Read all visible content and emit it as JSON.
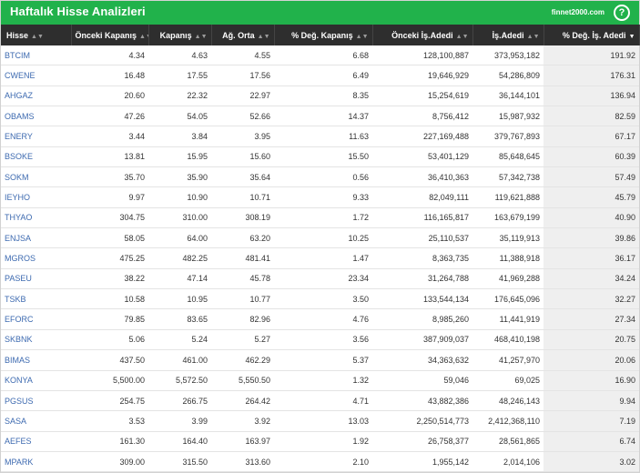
{
  "title": "Haftalık Hisse Analizleri",
  "brand": "finnet2000.com",
  "help": "?",
  "columns": [
    "Hisse",
    "Önceki Kapanış",
    "Kapanış",
    "Ağ. Orta",
    "% Değ. Kapanış",
    "Önceki İş.Adedi",
    "İş.Adedi",
    "% Değ. İş. Adedi"
  ],
  "sort_icons": {
    "both": "▲▼",
    "desc": "▼"
  },
  "rows": [
    [
      "BTCIM",
      "4.34",
      "4.63",
      "4.55",
      "6.68",
      "128,100,887",
      "373,953,182",
      "191.92"
    ],
    [
      "CWENE",
      "16.48",
      "17.55",
      "17.56",
      "6.49",
      "19,646,929",
      "54,286,809",
      "176.31"
    ],
    [
      "AHGAZ",
      "20.60",
      "22.32",
      "22.97",
      "8.35",
      "15,254,619",
      "36,144,101",
      "136.94"
    ],
    [
      "OBAMS",
      "47.26",
      "54.05",
      "52.66",
      "14.37",
      "8,756,412",
      "15,987,932",
      "82.59"
    ],
    [
      "ENERY",
      "3.44",
      "3.84",
      "3.95",
      "11.63",
      "227,169,488",
      "379,767,893",
      "67.17"
    ],
    [
      "BSOKE",
      "13.81",
      "15.95",
      "15.60",
      "15.50",
      "53,401,129",
      "85,648,645",
      "60.39"
    ],
    [
      "SOKM",
      "35.70",
      "35.90",
      "35.64",
      "0.56",
      "36,410,363",
      "57,342,738",
      "57.49"
    ],
    [
      "IEYHO",
      "9.97",
      "10.90",
      "10.71",
      "9.33",
      "82,049,111",
      "119,621,888",
      "45.79"
    ],
    [
      "THYAO",
      "304.75",
      "310.00",
      "308.19",
      "1.72",
      "116,165,817",
      "163,679,199",
      "40.90"
    ],
    [
      "ENJSA",
      "58.05",
      "64.00",
      "63.20",
      "10.25",
      "25,110,537",
      "35,119,913",
      "39.86"
    ],
    [
      "MGROS",
      "475.25",
      "482.25",
      "481.41",
      "1.47",
      "8,363,735",
      "11,388,918",
      "36.17"
    ],
    [
      "PASEU",
      "38.22",
      "47.14",
      "45.78",
      "23.34",
      "31,264,788",
      "41,969,288",
      "34.24"
    ],
    [
      "TSKB",
      "10.58",
      "10.95",
      "10.77",
      "3.50",
      "133,544,134",
      "176,645,096",
      "32.27"
    ],
    [
      "EFORC",
      "79.85",
      "83.65",
      "82.96",
      "4.76",
      "8,985,260",
      "11,441,919",
      "27.34"
    ],
    [
      "SKBNK",
      "5.06",
      "5.24",
      "5.27",
      "3.56",
      "387,909,037",
      "468,410,198",
      "20.75"
    ],
    [
      "BIMAS",
      "437.50",
      "461.00",
      "462.29",
      "5.37",
      "34,363,632",
      "41,257,970",
      "20.06"
    ],
    [
      "KONYA",
      "5,500.00",
      "5,572.50",
      "5,550.50",
      "1.32",
      "59,046",
      "69,025",
      "16.90"
    ],
    [
      "PGSUS",
      "254.75",
      "266.75",
      "264.42",
      "4.71",
      "43,882,386",
      "48,246,143",
      "9.94"
    ],
    [
      "SASA",
      "3.53",
      "3.99",
      "3.92",
      "13.03",
      "2,250,514,773",
      "2,412,368,110",
      "7.19"
    ],
    [
      "AEFES",
      "161.30",
      "164.40",
      "163.97",
      "1.92",
      "26,758,377",
      "28,561,865",
      "6.74"
    ],
    [
      "MPARK",
      "309.00",
      "315.50",
      "313.60",
      "2.10",
      "1,955,142",
      "2,014,106",
      "3.02"
    ]
  ]
}
